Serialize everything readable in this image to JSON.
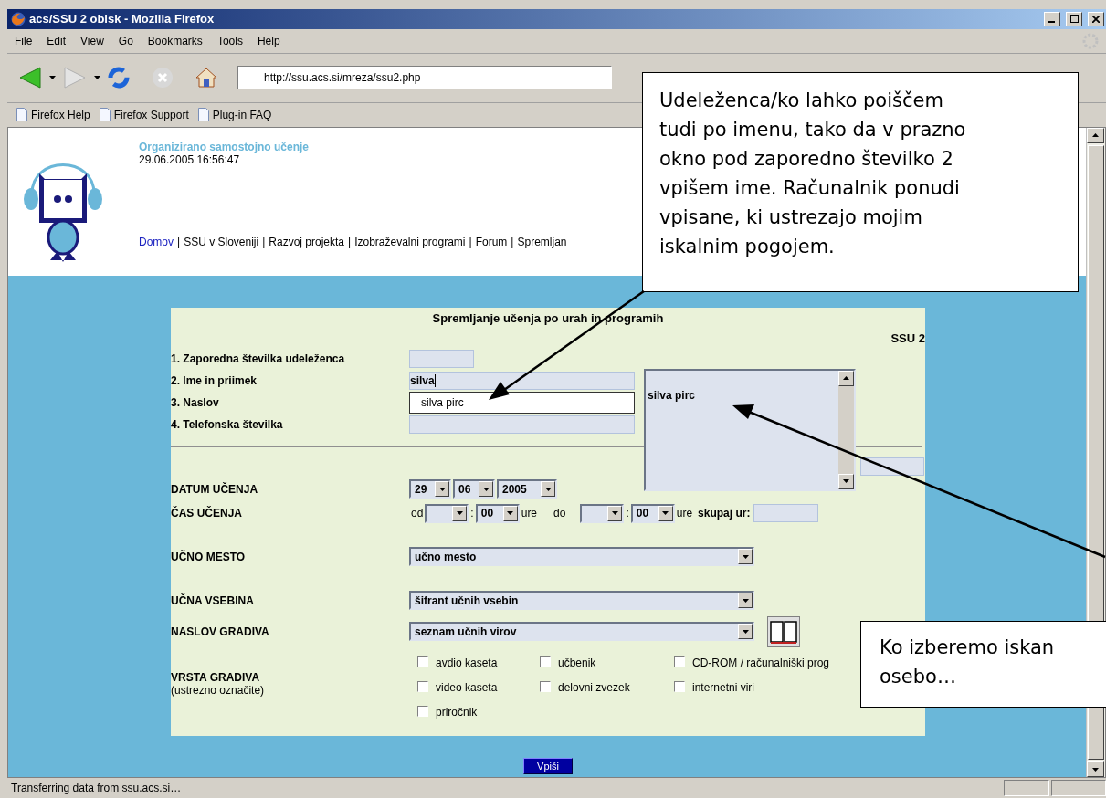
{
  "window": {
    "title": "acs/SSU 2 obisk - Mozilla Firefox"
  },
  "menu": [
    "File",
    "Edit",
    "View",
    "Go",
    "Bookmarks",
    "Tools",
    "Help"
  ],
  "address": {
    "value": "http://ssu.acs.si/mreza/ssu2.php"
  },
  "bookmarks": [
    "Firefox Help",
    "Firefox Support",
    "Plug-in FAQ"
  ],
  "site": {
    "title": "Organizirano samostojno učenje",
    "datetime": "29.06.2005 16:56:47",
    "separator": "|",
    "nav": [
      {
        "label": "Domov",
        "kind": "link"
      },
      {
        "label": "SSU v Sloveniji",
        "kind": "text"
      },
      {
        "label": "Razvoj projekta",
        "kind": "text"
      },
      {
        "label": "Izobraževalni programi",
        "kind": "text"
      },
      {
        "label": "Forum",
        "kind": "text"
      },
      {
        "label": "Spremljan",
        "kind": "text"
      }
    ]
  },
  "form": {
    "title": "Spremljanje učenja po urah in programih",
    "code": "SSU 2",
    "fields": [
      {
        "label": "1. Zaporedna številka udeleženca",
        "kind": "short",
        "focused": false
      },
      {
        "label": "2. Ime in priimek",
        "kind": "wide",
        "value": "silva",
        "focused": true
      },
      {
        "label": "3. Naslov",
        "kind": "hidden",
        "focused": false
      },
      {
        "label": "4. Telefonska številka",
        "kind": "wide",
        "focused": false
      }
    ],
    "suggestion": "silva pirc",
    "results": [
      "silva pirc"
    ],
    "date": {
      "label": "DATUM UČENJA",
      "selects": [
        "29",
        "06",
        "2005"
      ]
    },
    "time": {
      "label": "ČAS UČENJA",
      "parts": [
        {
          "kind": "text",
          "text": "od"
        },
        {
          "kind": "select"
        },
        {
          "kind": "text",
          "text": ":"
        },
        {
          "kind": "select",
          "value": "00"
        },
        {
          "kind": "text",
          "text": "ure"
        },
        {
          "kind": "text",
          "text": "do"
        },
        {
          "kind": "select"
        },
        {
          "kind": "text",
          "text": ":"
        },
        {
          "kind": "select",
          "value": "00"
        },
        {
          "kind": "text",
          "text": "ure"
        },
        {
          "kind": "bold",
          "text": "skupaj ur:"
        },
        {
          "kind": "input"
        }
      ]
    },
    "place": {
      "label": "UČNO MESTO",
      "value": "učno mesto"
    },
    "content": {
      "label": "UČNA VSEBINA",
      "value": "šifrant učnih vsebin"
    },
    "material": {
      "label": "NASLOV GRADIVA",
      "value": "seznam učnih virov"
    },
    "material_types": {
      "label": "VRSTA GRADIVA",
      "hint": "(ustrezno označite)",
      "options": [
        {
          "label": "avdio kaseta",
          "checked": false
        },
        {
          "label": "učbenik",
          "checked": false
        },
        {
          "label": "CD-ROM / računalniški prog",
          "checked": false
        },
        {
          "label": "video kaseta",
          "checked": false
        },
        {
          "label": "delovni zvezek",
          "checked": false
        },
        {
          "label": "internetni viri",
          "checked": false
        },
        {
          "label": "priročnik",
          "checked": false
        }
      ]
    },
    "submit": "Vpiši"
  },
  "callouts": [
    {
      "lines": [
        "Udeleženca/ko lahko poiščem",
        "tudi po imenu, tako da v prazno",
        "okno pod zaporedno številko 2",
        "vpišem ime. Računalnik ponudi",
        "vpisane, ki ustrezajo mojim",
        "iskalnim pogojem."
      ]
    },
    {
      "lines": [
        "Ko izberemo iskan",
        "osebo…"
      ]
    }
  ],
  "status": "Transferring data from ssu.acs.si…"
}
